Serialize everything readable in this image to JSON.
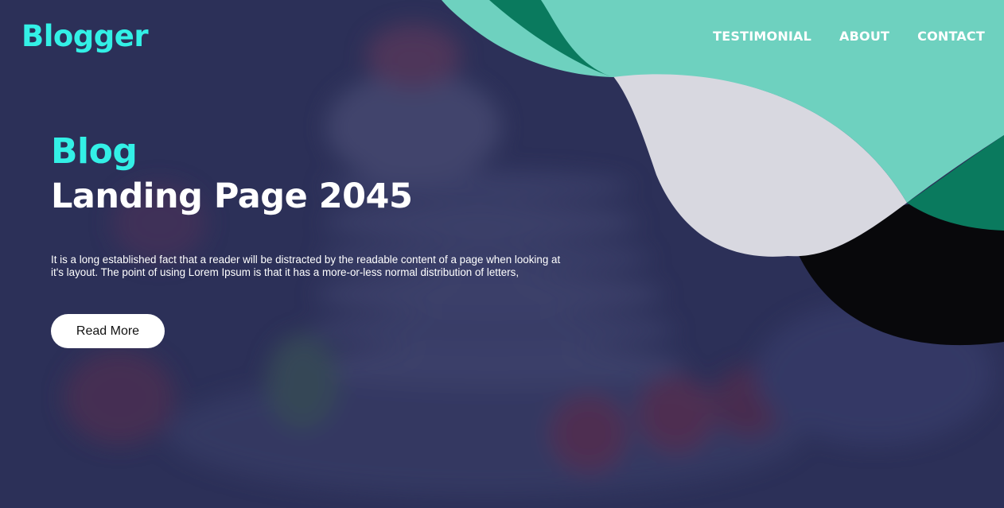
{
  "brand": {
    "logo_text": "Blogger"
  },
  "nav": {
    "items": [
      "TESTIMONIAL",
      "ABOUT",
      "CONTACT"
    ]
  },
  "hero": {
    "kicker": "Blog",
    "title": "Landing Page 2045",
    "description": "It is a long established fact that a reader will be distracted by the readable content of a page when looking at it's layout. The point of using Lorem Ipsum is that it has a more-or-less normal distribution of letters,",
    "cta_label": "Read More"
  },
  "colors": {
    "background": "#2c3058",
    "accent": "#33f0e6",
    "shape_teal_dark": "#0a7a5e",
    "shape_teal_light": "#6ed1bf",
    "shape_gray": "#d8d8e0",
    "shape_black": "#08080b"
  },
  "background_image": "blurred pancake stack with cherries"
}
